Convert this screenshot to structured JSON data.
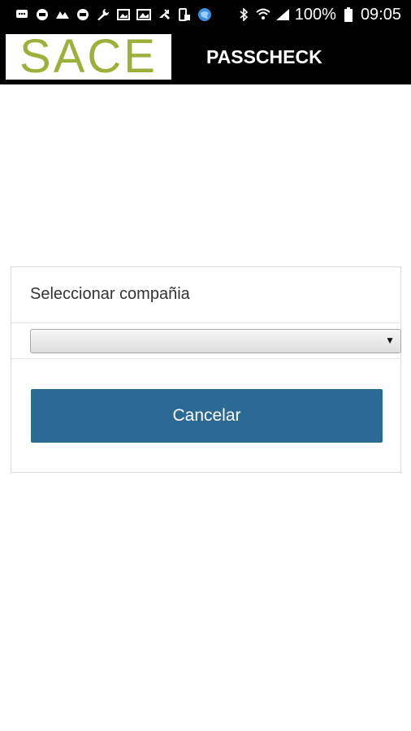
{
  "status_bar": {
    "notification_icons": [
      "message-icon",
      "bubble-icon",
      "photo-app-icon",
      "bubble-icon",
      "wrench-icon",
      "image-icon",
      "image-icon",
      "missed-call-icon",
      "phone-clipboard-icon",
      "globe-icon"
    ],
    "battery_percent": "100%",
    "time": "09:05"
  },
  "app_bar": {
    "logo_text": "SACE",
    "title": "PASSCHECK"
  },
  "card": {
    "label": "Seleccionar compañia",
    "select_value": "",
    "cancel_label": "Cancelar"
  },
  "colors": {
    "logo_green": "#9ab23a",
    "button_blue": "#2a6a94"
  }
}
